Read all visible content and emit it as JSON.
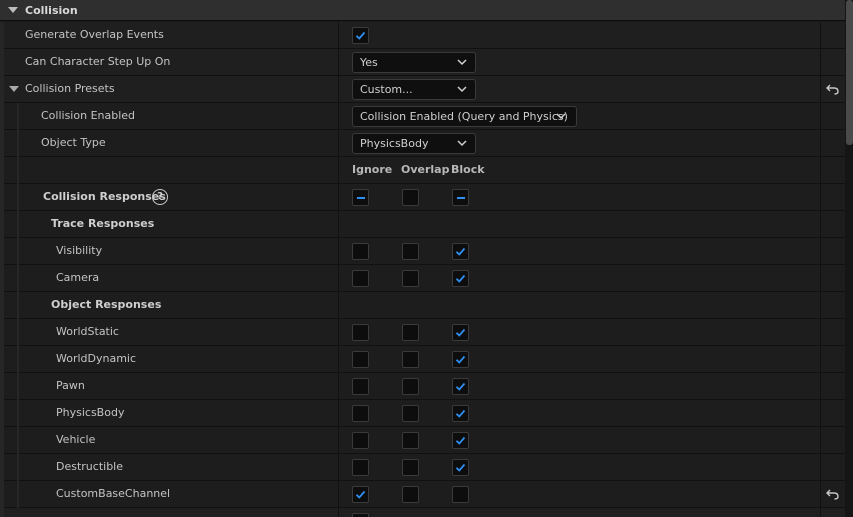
{
  "section": {
    "title": "Collision"
  },
  "rows": {
    "generate_overlap": {
      "label": "Generate Overlap Events",
      "checked": true
    },
    "step_up": {
      "label": "Can Character Step Up On",
      "value": "Yes"
    },
    "presets": {
      "label": "Collision Presets",
      "value": "Custom..."
    },
    "collision_enabled": {
      "label": "Collision Enabled",
      "value": "Collision Enabled (Query and Physics)"
    },
    "object_type": {
      "label": "Object Type",
      "value": "PhysicsBody"
    }
  },
  "columns": {
    "ignore": "Ignore",
    "overlap": "Overlap",
    "block": "Block"
  },
  "responses": {
    "label": "Collision Responses",
    "help_glyph": "?",
    "trace_label": "Trace Responses",
    "object_label": "Object Responses"
  },
  "trace_channels": [
    {
      "name": "Visibility",
      "ignore": false,
      "overlap": false,
      "block": true
    },
    {
      "name": "Camera",
      "ignore": false,
      "overlap": false,
      "block": true
    }
  ],
  "object_channels": [
    {
      "name": "WorldStatic",
      "ignore": false,
      "overlap": false,
      "block": true
    },
    {
      "name": "WorldDynamic",
      "ignore": false,
      "overlap": false,
      "block": true
    },
    {
      "name": "Pawn",
      "ignore": false,
      "overlap": false,
      "block": true
    },
    {
      "name": "PhysicsBody",
      "ignore": false,
      "overlap": false,
      "block": true
    },
    {
      "name": "Vehicle",
      "ignore": false,
      "overlap": false,
      "block": true
    },
    {
      "name": "Destructible",
      "ignore": false,
      "overlap": false,
      "block": true
    },
    {
      "name": "CustomBaseChannel",
      "ignore": true,
      "overlap": false,
      "block": false
    }
  ],
  "colors": {
    "accent": "#2f8ff0",
    "panel": "#1f1f1f",
    "header": "#2f2f2f"
  },
  "icons": {
    "check": "checkmark-icon",
    "reset": "reset-arrow-icon",
    "dropdown": "chevron-down-icon",
    "help": "help-icon"
  }
}
